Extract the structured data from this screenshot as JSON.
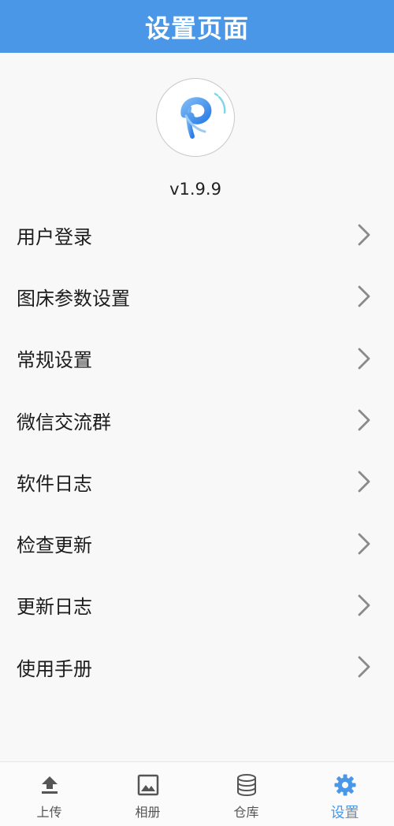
{
  "header": {
    "title": "设置页面"
  },
  "app": {
    "version": "v1.9.9",
    "logo_icon": "picbed-p-logo-icon"
  },
  "menu": {
    "items": [
      {
        "label": "用户登录"
      },
      {
        "label": "图床参数设置"
      },
      {
        "label": "常规设置"
      },
      {
        "label": "微信交流群"
      },
      {
        "label": "软件日志"
      },
      {
        "label": "检查更新"
      },
      {
        "label": "更新日志"
      },
      {
        "label": "使用手册"
      }
    ]
  },
  "tabbar": {
    "tabs": [
      {
        "label": "上传",
        "icon": "upload-icon",
        "active": false
      },
      {
        "label": "相册",
        "icon": "image-icon",
        "active": false
      },
      {
        "label": "仓库",
        "icon": "database-icon",
        "active": false
      },
      {
        "label": "设置",
        "icon": "gear-icon",
        "active": true
      }
    ]
  },
  "colors": {
    "primary": "#4a97e8",
    "background": "#f8f8f8",
    "arrow": "#8a8a8a"
  }
}
